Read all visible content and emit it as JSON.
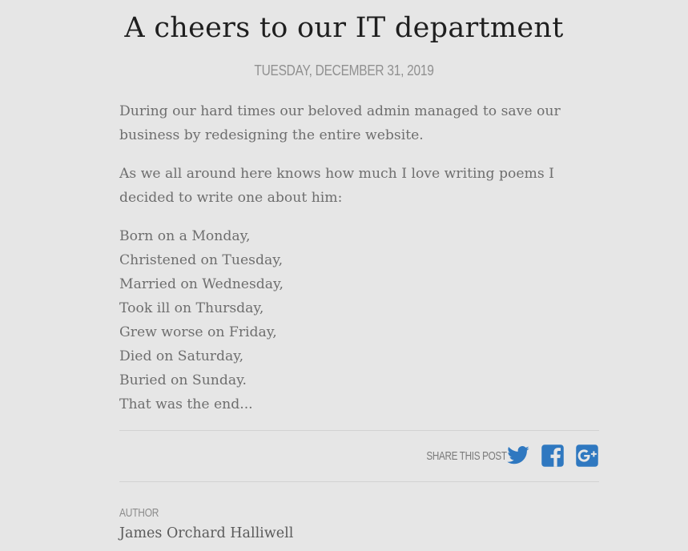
{
  "post": {
    "title": "A cheers to our IT department",
    "date": "TUESDAY, DECEMBER 31, 2019",
    "paragraphs": [
      "During our hard times our beloved admin managed to save our business by redesigning the entire website.",
      "As we all around here knows how much I love writing poems I decided to write one about him:"
    ],
    "poem": [
      "Born on a Monday,",
      "Christened on Tuesday,",
      "Married on Wednesday,",
      "Took ill on Thursday,",
      "Grew worse on Friday,",
      "Died on Saturday,",
      "Buried on Sunday.",
      "That was the end..."
    ]
  },
  "share": {
    "label": "SHARE THIS POST",
    "icons": [
      "twitter-icon",
      "facebook-icon",
      "google-plus-icon"
    ],
    "icon_color": "#2f78c0"
  },
  "author": {
    "label": "AUTHOR",
    "name": "James Orchard Halliwell"
  },
  "colors": {
    "background": "#e6e6e6",
    "title": "#1f1f1f",
    "body_text": "#6e6e6e",
    "muted": "#909090",
    "divider": "#d2d2d2"
  }
}
